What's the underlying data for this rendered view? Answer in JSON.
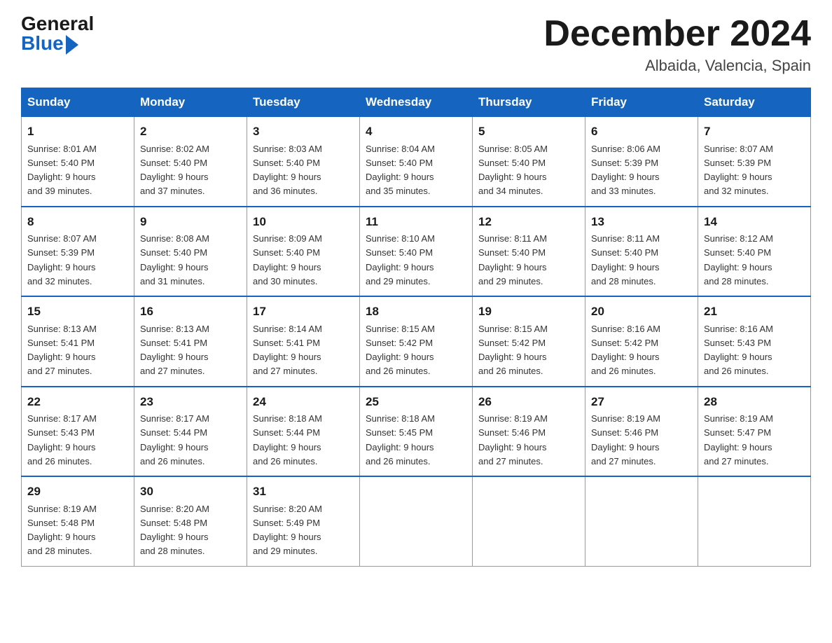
{
  "logo": {
    "general": "General",
    "blue": "Blue"
  },
  "title": "December 2024",
  "location": "Albaida, Valencia, Spain",
  "weekdays": [
    "Sunday",
    "Monday",
    "Tuesday",
    "Wednesday",
    "Thursday",
    "Friday",
    "Saturday"
  ],
  "weeks": [
    [
      {
        "day": "1",
        "sunrise": "8:01 AM",
        "sunset": "5:40 PM",
        "daylight": "9 hours and 39 minutes."
      },
      {
        "day": "2",
        "sunrise": "8:02 AM",
        "sunset": "5:40 PM",
        "daylight": "9 hours and 37 minutes."
      },
      {
        "day": "3",
        "sunrise": "8:03 AM",
        "sunset": "5:40 PM",
        "daylight": "9 hours and 36 minutes."
      },
      {
        "day": "4",
        "sunrise": "8:04 AM",
        "sunset": "5:40 PM",
        "daylight": "9 hours and 35 minutes."
      },
      {
        "day": "5",
        "sunrise": "8:05 AM",
        "sunset": "5:40 PM",
        "daylight": "9 hours and 34 minutes."
      },
      {
        "day": "6",
        "sunrise": "8:06 AM",
        "sunset": "5:39 PM",
        "daylight": "9 hours and 33 minutes."
      },
      {
        "day": "7",
        "sunrise": "8:07 AM",
        "sunset": "5:39 PM",
        "daylight": "9 hours and 32 minutes."
      }
    ],
    [
      {
        "day": "8",
        "sunrise": "8:07 AM",
        "sunset": "5:39 PM",
        "daylight": "9 hours and 32 minutes."
      },
      {
        "day": "9",
        "sunrise": "8:08 AM",
        "sunset": "5:40 PM",
        "daylight": "9 hours and 31 minutes."
      },
      {
        "day": "10",
        "sunrise": "8:09 AM",
        "sunset": "5:40 PM",
        "daylight": "9 hours and 30 minutes."
      },
      {
        "day": "11",
        "sunrise": "8:10 AM",
        "sunset": "5:40 PM",
        "daylight": "9 hours and 29 minutes."
      },
      {
        "day": "12",
        "sunrise": "8:11 AM",
        "sunset": "5:40 PM",
        "daylight": "9 hours and 29 minutes."
      },
      {
        "day": "13",
        "sunrise": "8:11 AM",
        "sunset": "5:40 PM",
        "daylight": "9 hours and 28 minutes."
      },
      {
        "day": "14",
        "sunrise": "8:12 AM",
        "sunset": "5:40 PM",
        "daylight": "9 hours and 28 minutes."
      }
    ],
    [
      {
        "day": "15",
        "sunrise": "8:13 AM",
        "sunset": "5:41 PM",
        "daylight": "9 hours and 27 minutes."
      },
      {
        "day": "16",
        "sunrise": "8:13 AM",
        "sunset": "5:41 PM",
        "daylight": "9 hours and 27 minutes."
      },
      {
        "day": "17",
        "sunrise": "8:14 AM",
        "sunset": "5:41 PM",
        "daylight": "9 hours and 27 minutes."
      },
      {
        "day": "18",
        "sunrise": "8:15 AM",
        "sunset": "5:42 PM",
        "daylight": "9 hours and 26 minutes."
      },
      {
        "day": "19",
        "sunrise": "8:15 AM",
        "sunset": "5:42 PM",
        "daylight": "9 hours and 26 minutes."
      },
      {
        "day": "20",
        "sunrise": "8:16 AM",
        "sunset": "5:42 PM",
        "daylight": "9 hours and 26 minutes."
      },
      {
        "day": "21",
        "sunrise": "8:16 AM",
        "sunset": "5:43 PM",
        "daylight": "9 hours and 26 minutes."
      }
    ],
    [
      {
        "day": "22",
        "sunrise": "8:17 AM",
        "sunset": "5:43 PM",
        "daylight": "9 hours and 26 minutes."
      },
      {
        "day": "23",
        "sunrise": "8:17 AM",
        "sunset": "5:44 PM",
        "daylight": "9 hours and 26 minutes."
      },
      {
        "day": "24",
        "sunrise": "8:18 AM",
        "sunset": "5:44 PM",
        "daylight": "9 hours and 26 minutes."
      },
      {
        "day": "25",
        "sunrise": "8:18 AM",
        "sunset": "5:45 PM",
        "daylight": "9 hours and 26 minutes."
      },
      {
        "day": "26",
        "sunrise": "8:19 AM",
        "sunset": "5:46 PM",
        "daylight": "9 hours and 27 minutes."
      },
      {
        "day": "27",
        "sunrise": "8:19 AM",
        "sunset": "5:46 PM",
        "daylight": "9 hours and 27 minutes."
      },
      {
        "day": "28",
        "sunrise": "8:19 AM",
        "sunset": "5:47 PM",
        "daylight": "9 hours and 27 minutes."
      }
    ],
    [
      {
        "day": "29",
        "sunrise": "8:19 AM",
        "sunset": "5:48 PM",
        "daylight": "9 hours and 28 minutes."
      },
      {
        "day": "30",
        "sunrise": "8:20 AM",
        "sunset": "5:48 PM",
        "daylight": "9 hours and 28 minutes."
      },
      {
        "day": "31",
        "sunrise": "8:20 AM",
        "sunset": "5:49 PM",
        "daylight": "9 hours and 29 minutes."
      },
      null,
      null,
      null,
      null
    ]
  ],
  "labels": {
    "sunrise": "Sunrise:",
    "sunset": "Sunset:",
    "daylight": "Daylight:"
  }
}
